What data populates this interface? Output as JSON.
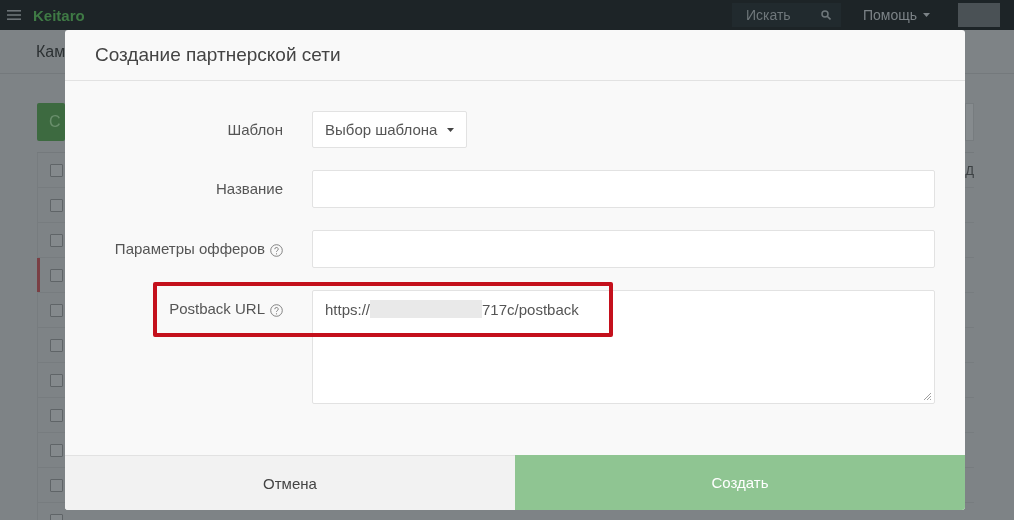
{
  "navbar": {
    "logo": "Keitaro",
    "search": {
      "placeholder": "Искать"
    },
    "help_menu": "Помощь"
  },
  "background": {
    "breadcrumb": "Кам",
    "create_button": "С",
    "column_header": "Д",
    "header_checked": false,
    "rows": [
      {
        "checked": false,
        "marked": false
      },
      {
        "checked": false,
        "marked": false
      },
      {
        "checked": false,
        "marked": true
      },
      {
        "checked": false,
        "marked": false
      },
      {
        "checked": false,
        "marked": false
      },
      {
        "checked": false,
        "marked": false
      },
      {
        "checked": false,
        "marked": false
      },
      {
        "checked": false,
        "marked": false
      },
      {
        "checked": false,
        "marked": false
      },
      {
        "checked": false,
        "marked": false
      }
    ]
  },
  "modal": {
    "title": "Создание партнерской сети",
    "fields": [
      {
        "kind": "select",
        "label": "Шаблон",
        "value": "Выбор шаблона",
        "help": false,
        "highlighted": false
      },
      {
        "kind": "text",
        "label": "Название",
        "help": false,
        "highlighted": false
      },
      {
        "kind": "text",
        "label": "Параметры офферов",
        "help": true,
        "highlighted": false
      },
      {
        "kind": "textarea",
        "label": "Postback URL",
        "help": true,
        "highlighted": true,
        "value_prefix": "https://",
        "value_suffix": "717c/postback",
        "redacted": true
      }
    ],
    "buttons": [
      {
        "kind": "cancel",
        "label": "Отмена"
      },
      {
        "kind": "primary",
        "label": "Создать",
        "disabled": true
      }
    ]
  }
}
